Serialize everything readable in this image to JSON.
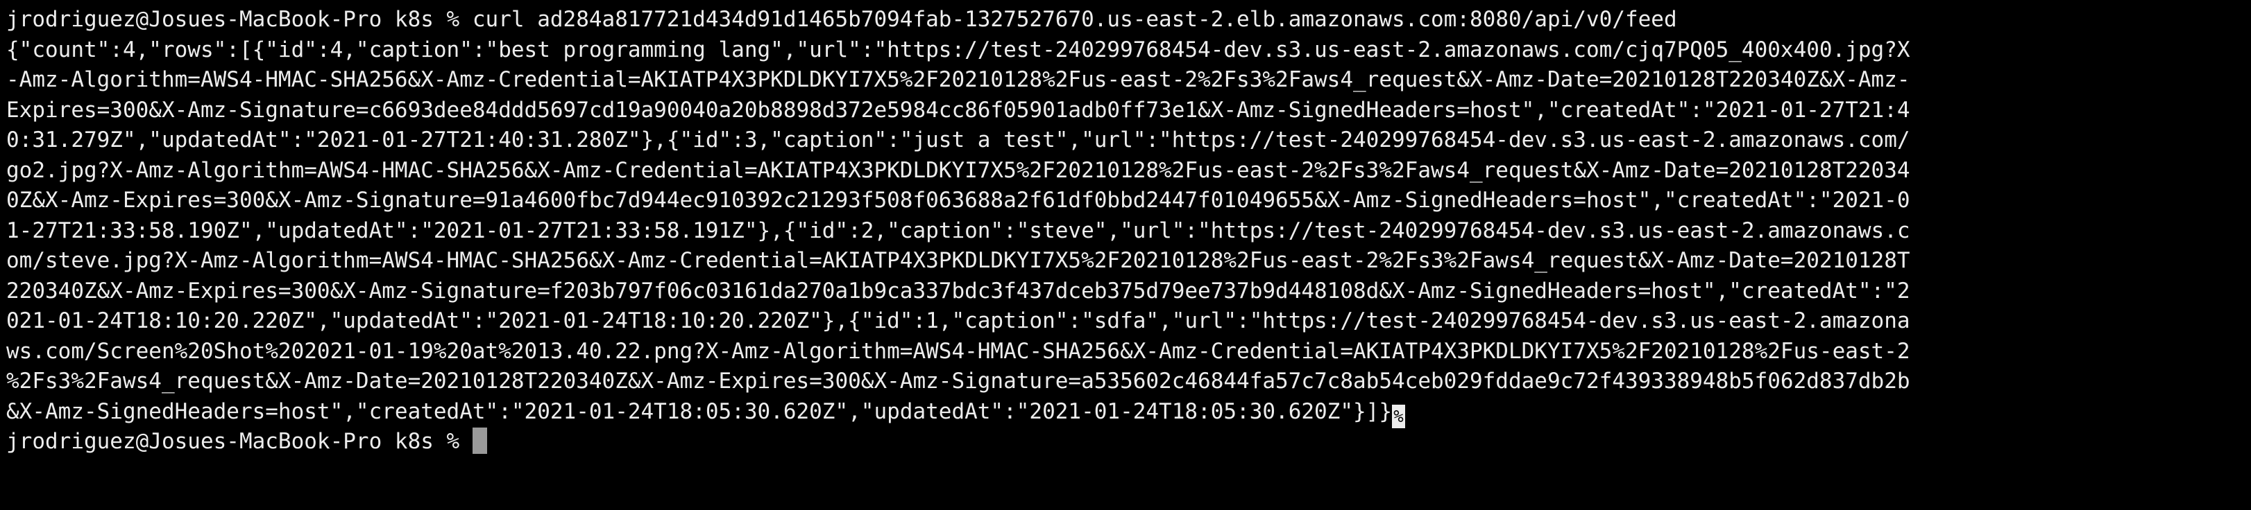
{
  "terminal": {
    "prompt": "jrodriguez@Josues-MacBook-Pro k8s % ",
    "command": "curl ad284a817721d434d91d1465b7094fab-1327527670.us-east-2.elb.amazonaws.com:8080/api/v0/feed",
    "output_lines": [
      "{\"count\":4,\"rows\":[{\"id\":4,\"caption\":\"best programming lang\",\"url\":\"https://test-240299768454-dev.s3.us-east-2.amazonaws.com/cjq7PQ05_400x400.jpg?X",
      "-Amz-Algorithm=AWS4-HMAC-SHA256&X-Amz-Credential=AKIATP4X3PKDLDKYI7X5%2F20210128%2Fus-east-2%2Fs3%2Faws4_request&X-Amz-Date=20210128T220340Z&X-Amz-",
      "Expires=300&X-Amz-Signature=c6693dee84ddd5697cd19a90040a20b8898d372e5984cc86f05901adb0ff73e1&X-Amz-SignedHeaders=host\",\"createdAt\":\"2021-01-27T21:4",
      "0:31.279Z\",\"updatedAt\":\"2021-01-27T21:40:31.280Z\"},{\"id\":3,\"caption\":\"just a test\",\"url\":\"https://test-240299768454-dev.s3.us-east-2.amazonaws.com/",
      "go2.jpg?X-Amz-Algorithm=AWS4-HMAC-SHA256&X-Amz-Credential=AKIATP4X3PKDLDKYI7X5%2F20210128%2Fus-east-2%2Fs3%2Faws4_request&X-Amz-Date=20210128T22034",
      "0Z&X-Amz-Expires=300&X-Amz-Signature=91a4600fbc7d944ec910392c21293f508f063688a2f61df0bbd2447f01049655&X-Amz-SignedHeaders=host\",\"createdAt\":\"2021-0",
      "1-27T21:33:58.190Z\",\"updatedAt\":\"2021-01-27T21:33:58.191Z\"},{\"id\":2,\"caption\":\"steve\",\"url\":\"https://test-240299768454-dev.s3.us-east-2.amazonaws.c",
      "om/steve.jpg?X-Amz-Algorithm=AWS4-HMAC-SHA256&X-Amz-Credential=AKIATP4X3PKDLDKYI7X5%2F20210128%2Fus-east-2%2Fs3%2Faws4_request&X-Amz-Date=20210128T",
      "220340Z&X-Amz-Expires=300&X-Amz-Signature=f203b797f06c03161da270a1b9ca337bdc3f437dceb375d79ee737b9d448108d&X-Amz-SignedHeaders=host\",\"createdAt\":\"2",
      "021-01-24T18:10:20.220Z\",\"updatedAt\":\"2021-01-24T18:10:20.220Z\"},{\"id\":1,\"caption\":\"sdfa\",\"url\":\"https://test-240299768454-dev.s3.us-east-2.amazona",
      "ws.com/Screen%20Shot%202021-01-19%20at%2013.40.22.png?X-Amz-Algorithm=AWS4-HMAC-SHA256&X-Amz-Credential=AKIATP4X3PKDLDKYI7X5%2F20210128%2Fus-east-2",
      "%2Fs3%2Faws4_request&X-Amz-Date=20210128T220340Z&X-Amz-Expires=300&X-Amz-Signature=a535602c46844fa57c7c8ab54ceb029fddae9c72f439338948b5f062d837db2b",
      "&X-Amz-SignedHeaders=host\",\"createdAt\":\"2021-01-24T18:05:30.620Z\",\"updatedAt\":\"2021-01-24T18:05:30.620Z\"}]}"
    ],
    "eol_marker": "%",
    "colors": {
      "background": "#000000",
      "text": "#ededed",
      "cursor": "#9a9a9a"
    }
  }
}
